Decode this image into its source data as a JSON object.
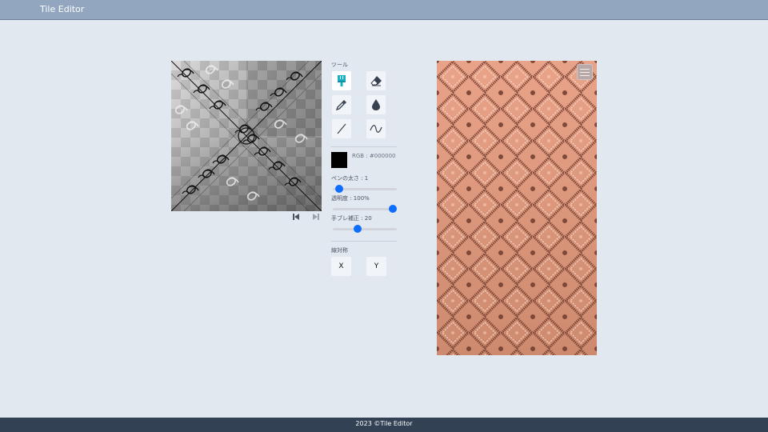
{
  "app": {
    "title": "Tile Editor"
  },
  "tools": {
    "label": "ツール",
    "items": [
      {
        "name": "brush-icon",
        "active": true
      },
      {
        "name": "eraser-icon",
        "active": false
      },
      {
        "name": "eyedropper-icon",
        "active": false
      },
      {
        "name": "fill-drop-icon",
        "active": false
      },
      {
        "name": "line-icon",
        "active": false
      },
      {
        "name": "curve-icon",
        "active": false
      }
    ]
  },
  "color": {
    "label": "RGB : #000000",
    "value": "#000000"
  },
  "sliders": {
    "pen_size": {
      "label": "ペンの太さ : 1",
      "fraction": 0.04
    },
    "opacity": {
      "label": "透明度 : 100%",
      "fraction": 1.0
    },
    "smoothing": {
      "label": "手ブレ補正 : 20",
      "fraction": 0.37
    }
  },
  "symmetry": {
    "label": "線対称",
    "x_label": "X",
    "y_label": "Y"
  },
  "colors": {
    "accent": "#0d6efd",
    "tool_active": "#1ab0c4",
    "preview_top": "#e9a389",
    "preview_bottom": "#cd8a6e"
  },
  "footer": {
    "copyright": "2023 ©Tile Editor"
  }
}
